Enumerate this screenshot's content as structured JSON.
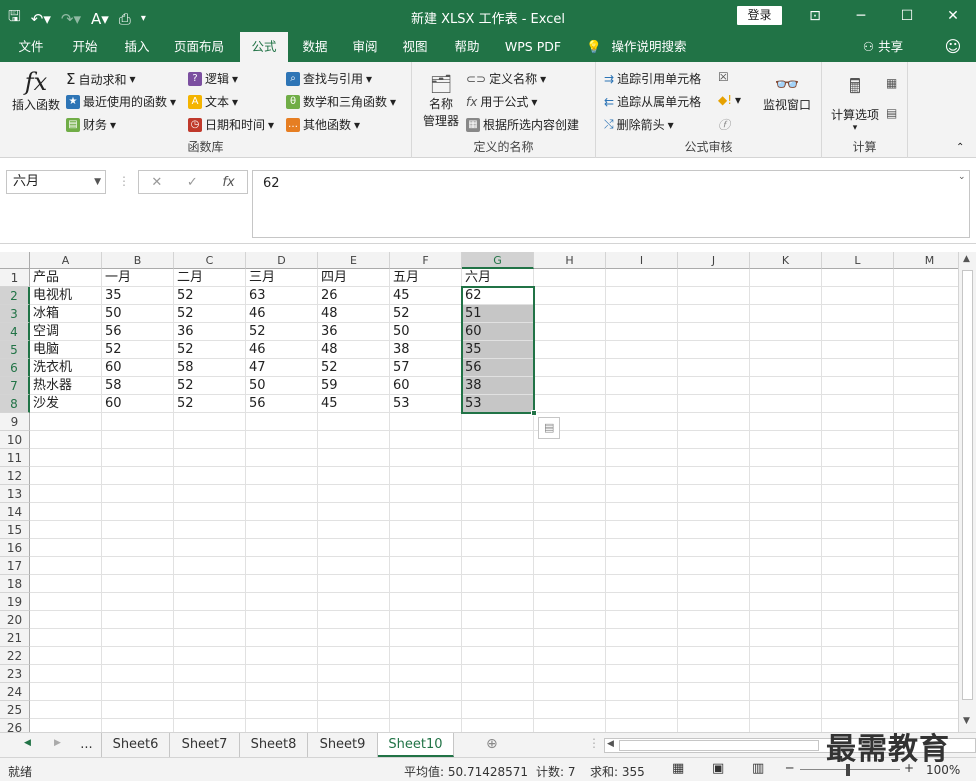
{
  "window": {
    "title": "新建 XLSX 工作表 - Excel",
    "login": "登录"
  },
  "tabs": [
    "文件",
    "开始",
    "插入",
    "页面布局",
    "公式",
    "数据",
    "审阅",
    "视图",
    "帮助",
    "WPS PDF",
    "操作说明搜索"
  ],
  "share": "共享",
  "ribbon": {
    "insert_function": "插入函数",
    "funclib": {
      "autosum": "自动求和",
      "recent": "最近使用的函数",
      "finance": "财务",
      "logic": "逻辑",
      "text": "文本",
      "datetime": "日期和时间",
      "lookup": "查找与引用",
      "math": "数学和三角函数",
      "other": "其他函数",
      "label": "函数库"
    },
    "names": {
      "manager": "名称管理器",
      "manager_l1": "名称",
      "manager_l2": "管理器",
      "define": "定义名称",
      "use": "用于公式",
      "create": "根据所选内容创建",
      "label": "定义的名称"
    },
    "audit": {
      "trace_prec": "追踪引用单元格",
      "trace_dep": "追踪从属单元格",
      "remove": "删除箭头",
      "watch": "监视窗口",
      "label": "公式审核"
    },
    "calc": {
      "options": "计算选项",
      "label": "计算"
    }
  },
  "formula_bar": {
    "namebox": "六月",
    "value": "62"
  },
  "columns": [
    "A",
    "B",
    "C",
    "D",
    "E",
    "F",
    "G",
    "H",
    "I",
    "J",
    "K",
    "L",
    "M"
  ],
  "rows": [
    "1",
    "2",
    "3",
    "4",
    "5",
    "6",
    "7",
    "8",
    "9",
    "10",
    "11",
    "12",
    "13",
    "14",
    "15",
    "16",
    "17",
    "18",
    "19",
    "20",
    "21",
    "22",
    "23",
    "24",
    "25",
    "26"
  ],
  "table": [
    [
      "产品",
      "一月",
      "二月",
      "三月",
      "四月",
      "五月",
      "六月"
    ],
    [
      "电视机",
      "35",
      "52",
      "63",
      "26",
      "45",
      "62"
    ],
    [
      "冰箱",
      "50",
      "52",
      "46",
      "48",
      "52",
      "51"
    ],
    [
      "空调",
      "56",
      "36",
      "52",
      "36",
      "50",
      "60"
    ],
    [
      "电脑",
      "52",
      "52",
      "46",
      "48",
      "38",
      "35"
    ],
    [
      "洗衣机",
      "60",
      "58",
      "47",
      "52",
      "57",
      "56"
    ],
    [
      "热水器",
      "58",
      "52",
      "50",
      "59",
      "60",
      "38"
    ],
    [
      "沙发",
      "60",
      "52",
      "56",
      "45",
      "53",
      "53"
    ]
  ],
  "sheets": {
    "ellipsis": "...",
    "items": [
      "Sheet6",
      "Sheet7",
      "Sheet8",
      "Sheet9",
      "Sheet10"
    ],
    "active": "Sheet10"
  },
  "status": {
    "ready": "就绪",
    "average": "平均值: 50.71428571",
    "count": "计数: 7",
    "sum": "求和: 355",
    "zoom": "100%"
  },
  "watermark": "最需教育"
}
